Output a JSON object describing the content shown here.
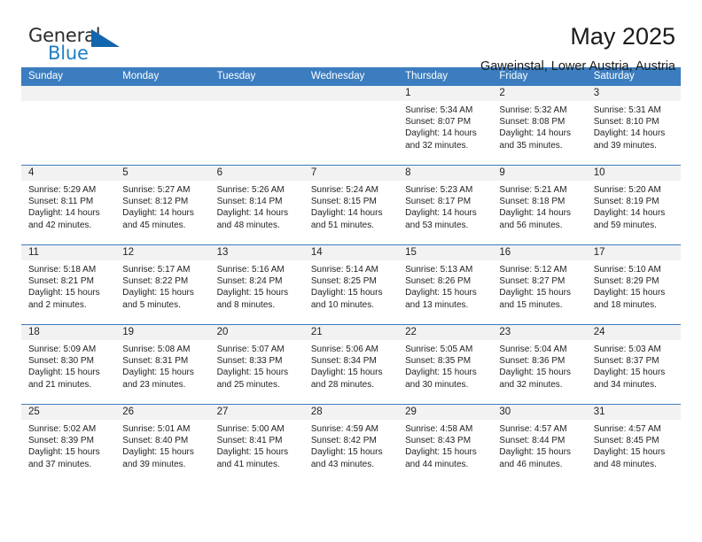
{
  "brand": {
    "name_part1": "General",
    "name_part2": "Blue",
    "triangle_color": "#1266ad",
    "blue_text_color": "#1f7fc4"
  },
  "header": {
    "title": "May 2025",
    "subtitle": "Gaweinstal, Lower Austria, Austria"
  },
  "calendar": {
    "accent_color": "#3b7dbf",
    "daynum_bg": "#f2f2f2",
    "weekdays": [
      "Sunday",
      "Monday",
      "Tuesday",
      "Wednesday",
      "Thursday",
      "Friday",
      "Saturday"
    ],
    "weeks": [
      [
        {
          "day": "",
          "sunrise": "",
          "sunset": "",
          "daylight1": "",
          "daylight2": ""
        },
        {
          "day": "",
          "sunrise": "",
          "sunset": "",
          "daylight1": "",
          "daylight2": ""
        },
        {
          "day": "",
          "sunrise": "",
          "sunset": "",
          "daylight1": "",
          "daylight2": ""
        },
        {
          "day": "",
          "sunrise": "",
          "sunset": "",
          "daylight1": "",
          "daylight2": ""
        },
        {
          "day": "1",
          "sunrise": "Sunrise: 5:34 AM",
          "sunset": "Sunset: 8:07 PM",
          "daylight1": "Daylight: 14 hours",
          "daylight2": "and 32 minutes."
        },
        {
          "day": "2",
          "sunrise": "Sunrise: 5:32 AM",
          "sunset": "Sunset: 8:08 PM",
          "daylight1": "Daylight: 14 hours",
          "daylight2": "and 35 minutes."
        },
        {
          "day": "3",
          "sunrise": "Sunrise: 5:31 AM",
          "sunset": "Sunset: 8:10 PM",
          "daylight1": "Daylight: 14 hours",
          "daylight2": "and 39 minutes."
        }
      ],
      [
        {
          "day": "4",
          "sunrise": "Sunrise: 5:29 AM",
          "sunset": "Sunset: 8:11 PM",
          "daylight1": "Daylight: 14 hours",
          "daylight2": "and 42 minutes."
        },
        {
          "day": "5",
          "sunrise": "Sunrise: 5:27 AM",
          "sunset": "Sunset: 8:12 PM",
          "daylight1": "Daylight: 14 hours",
          "daylight2": "and 45 minutes."
        },
        {
          "day": "6",
          "sunrise": "Sunrise: 5:26 AM",
          "sunset": "Sunset: 8:14 PM",
          "daylight1": "Daylight: 14 hours",
          "daylight2": "and 48 minutes."
        },
        {
          "day": "7",
          "sunrise": "Sunrise: 5:24 AM",
          "sunset": "Sunset: 8:15 PM",
          "daylight1": "Daylight: 14 hours",
          "daylight2": "and 51 minutes."
        },
        {
          "day": "8",
          "sunrise": "Sunrise: 5:23 AM",
          "sunset": "Sunset: 8:17 PM",
          "daylight1": "Daylight: 14 hours",
          "daylight2": "and 53 minutes."
        },
        {
          "day": "9",
          "sunrise": "Sunrise: 5:21 AM",
          "sunset": "Sunset: 8:18 PM",
          "daylight1": "Daylight: 14 hours",
          "daylight2": "and 56 minutes."
        },
        {
          "day": "10",
          "sunrise": "Sunrise: 5:20 AM",
          "sunset": "Sunset: 8:19 PM",
          "daylight1": "Daylight: 14 hours",
          "daylight2": "and 59 minutes."
        }
      ],
      [
        {
          "day": "11",
          "sunrise": "Sunrise: 5:18 AM",
          "sunset": "Sunset: 8:21 PM",
          "daylight1": "Daylight: 15 hours",
          "daylight2": "and 2 minutes."
        },
        {
          "day": "12",
          "sunrise": "Sunrise: 5:17 AM",
          "sunset": "Sunset: 8:22 PM",
          "daylight1": "Daylight: 15 hours",
          "daylight2": "and 5 minutes."
        },
        {
          "day": "13",
          "sunrise": "Sunrise: 5:16 AM",
          "sunset": "Sunset: 8:24 PM",
          "daylight1": "Daylight: 15 hours",
          "daylight2": "and 8 minutes."
        },
        {
          "day": "14",
          "sunrise": "Sunrise: 5:14 AM",
          "sunset": "Sunset: 8:25 PM",
          "daylight1": "Daylight: 15 hours",
          "daylight2": "and 10 minutes."
        },
        {
          "day": "15",
          "sunrise": "Sunrise: 5:13 AM",
          "sunset": "Sunset: 8:26 PM",
          "daylight1": "Daylight: 15 hours",
          "daylight2": "and 13 minutes."
        },
        {
          "day": "16",
          "sunrise": "Sunrise: 5:12 AM",
          "sunset": "Sunset: 8:27 PM",
          "daylight1": "Daylight: 15 hours",
          "daylight2": "and 15 minutes."
        },
        {
          "day": "17",
          "sunrise": "Sunrise: 5:10 AM",
          "sunset": "Sunset: 8:29 PM",
          "daylight1": "Daylight: 15 hours",
          "daylight2": "and 18 minutes."
        }
      ],
      [
        {
          "day": "18",
          "sunrise": "Sunrise: 5:09 AM",
          "sunset": "Sunset: 8:30 PM",
          "daylight1": "Daylight: 15 hours",
          "daylight2": "and 21 minutes."
        },
        {
          "day": "19",
          "sunrise": "Sunrise: 5:08 AM",
          "sunset": "Sunset: 8:31 PM",
          "daylight1": "Daylight: 15 hours",
          "daylight2": "and 23 minutes."
        },
        {
          "day": "20",
          "sunrise": "Sunrise: 5:07 AM",
          "sunset": "Sunset: 8:33 PM",
          "daylight1": "Daylight: 15 hours",
          "daylight2": "and 25 minutes."
        },
        {
          "day": "21",
          "sunrise": "Sunrise: 5:06 AM",
          "sunset": "Sunset: 8:34 PM",
          "daylight1": "Daylight: 15 hours",
          "daylight2": "and 28 minutes."
        },
        {
          "day": "22",
          "sunrise": "Sunrise: 5:05 AM",
          "sunset": "Sunset: 8:35 PM",
          "daylight1": "Daylight: 15 hours",
          "daylight2": "and 30 minutes."
        },
        {
          "day": "23",
          "sunrise": "Sunrise: 5:04 AM",
          "sunset": "Sunset: 8:36 PM",
          "daylight1": "Daylight: 15 hours",
          "daylight2": "and 32 minutes."
        },
        {
          "day": "24",
          "sunrise": "Sunrise: 5:03 AM",
          "sunset": "Sunset: 8:37 PM",
          "daylight1": "Daylight: 15 hours",
          "daylight2": "and 34 minutes."
        }
      ],
      [
        {
          "day": "25",
          "sunrise": "Sunrise: 5:02 AM",
          "sunset": "Sunset: 8:39 PM",
          "daylight1": "Daylight: 15 hours",
          "daylight2": "and 37 minutes."
        },
        {
          "day": "26",
          "sunrise": "Sunrise: 5:01 AM",
          "sunset": "Sunset: 8:40 PM",
          "daylight1": "Daylight: 15 hours",
          "daylight2": "and 39 minutes."
        },
        {
          "day": "27",
          "sunrise": "Sunrise: 5:00 AM",
          "sunset": "Sunset: 8:41 PM",
          "daylight1": "Daylight: 15 hours",
          "daylight2": "and 41 minutes."
        },
        {
          "day": "28",
          "sunrise": "Sunrise: 4:59 AM",
          "sunset": "Sunset: 8:42 PM",
          "daylight1": "Daylight: 15 hours",
          "daylight2": "and 43 minutes."
        },
        {
          "day": "29",
          "sunrise": "Sunrise: 4:58 AM",
          "sunset": "Sunset: 8:43 PM",
          "daylight1": "Daylight: 15 hours",
          "daylight2": "and 44 minutes."
        },
        {
          "day": "30",
          "sunrise": "Sunrise: 4:57 AM",
          "sunset": "Sunset: 8:44 PM",
          "daylight1": "Daylight: 15 hours",
          "daylight2": "and 46 minutes."
        },
        {
          "day": "31",
          "sunrise": "Sunrise: 4:57 AM",
          "sunset": "Sunset: 8:45 PM",
          "daylight1": "Daylight: 15 hours",
          "daylight2": "and 48 minutes."
        }
      ]
    ]
  }
}
